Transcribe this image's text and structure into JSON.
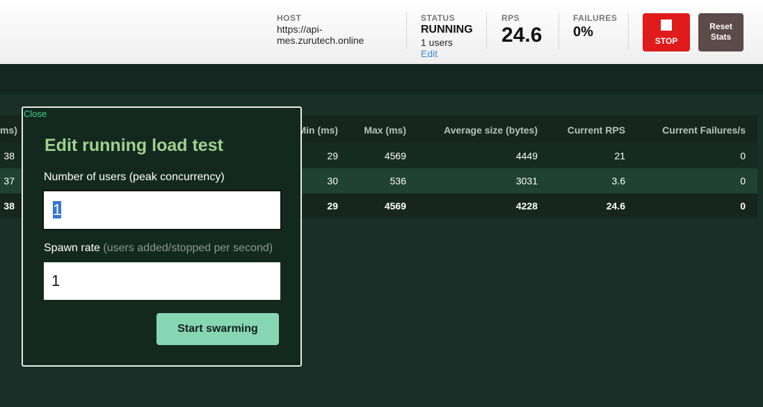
{
  "header": {
    "host_label": "HOST",
    "host_value": "https://api-mes.zurutech.online",
    "status_label": "STATUS",
    "status_value": "RUNNING",
    "users_value": "1 users",
    "edit_label": "Edit",
    "rps_label": "RPS",
    "rps_value": "24.6",
    "failures_label": "FAILURES",
    "failures_value": "0%",
    "stop_label": "STOP",
    "reset_label": "Reset Stats"
  },
  "stats_table": {
    "columns": [
      "ms)",
      "Min (ms)",
      "Max (ms)",
      "Average size (bytes)",
      "Current RPS",
      "Current Failures/s"
    ],
    "rows": [
      [
        "38",
        "29",
        "4569",
        "4449",
        "21",
        "0"
      ],
      [
        "37",
        "30",
        "536",
        "3031",
        "3.6",
        "0"
      ],
      [
        "38",
        "29",
        "4569",
        "4228",
        "24.6",
        "0"
      ]
    ]
  },
  "modal": {
    "close_label": "Close",
    "title": "Edit running load test",
    "users_label": "Number of users (peak concurrency)",
    "users_value": "1",
    "spawn_label": "Spawn rate",
    "spawn_hint": "(users added/stopped per second)",
    "spawn_value": "1",
    "submit_label": "Start swarming"
  },
  "colors": {
    "background": "#183028",
    "stop_button": "#e01b1b",
    "reset_button": "#5c4b4b",
    "submit_button": "#87d6b3",
    "modal_title": "#9fd28c",
    "close_link": "#3ad28a",
    "edit_link": "#3b8ed6"
  },
  "icons": {
    "stop": "stop-square-icon"
  }
}
